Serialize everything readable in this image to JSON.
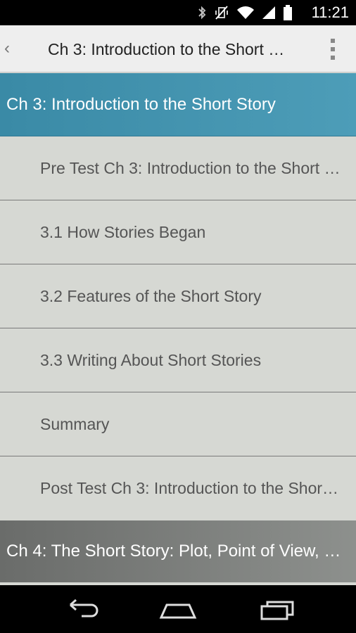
{
  "status_bar": {
    "time": "11:21",
    "icons": [
      "bluetooth-icon",
      "vibrate-off-icon",
      "wifi-icon",
      "signal-icon",
      "battery-icon"
    ]
  },
  "action_bar": {
    "title": "Ch 3: Introduction to the Short Story"
  },
  "chapters": {
    "current": "Ch 3: Introduction to the Short Story",
    "next": "Ch 4: The Short Story: Plot, Point of View, and Character"
  },
  "items": [
    "Pre  Test Ch 3: Introduction to the Short Story",
    "3.1 How Stories Began",
    "3.2 Features of the Short Story",
    "3.3 Writing About Short Stories",
    "Summary",
    "Post  Test Ch 3: Introduction to the Short Story"
  ],
  "colors": {
    "active_chapter": "#3a8aa6",
    "list_background": "#d6d8d3",
    "item_text": "#555555"
  }
}
